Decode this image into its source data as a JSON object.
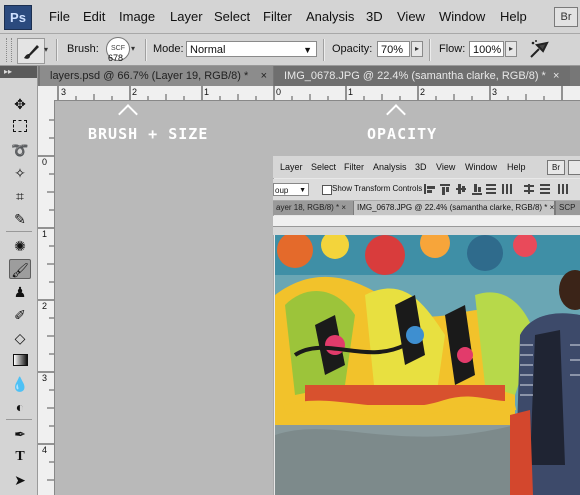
{
  "app": {
    "logo": "Ps",
    "br_badge": "Br"
  },
  "menu": [
    "File",
    "Edit",
    "Image",
    "Layer",
    "Select",
    "Filter",
    "Analysis",
    "3D",
    "View",
    "Window",
    "Help"
  ],
  "options": {
    "brush_label": "Brush:",
    "brush_size": "678",
    "brush_preview_text": "SCF",
    "mode_label": "Mode:",
    "mode_value": "Normal",
    "opacity_label": "Opacity:",
    "opacity_value": "70%",
    "flow_label": "Flow:",
    "flow_value": "100%"
  },
  "tabs": [
    {
      "label": "layers.psd @ 66.7% (Layer 19, RGB/8) *",
      "close": "×"
    },
    {
      "label": "IMG_0678.JPG @ 22.4% (samantha clarke, RGB/8) *",
      "close": "×"
    }
  ],
  "ruler_top": [
    "3",
    "2",
    "1",
    "0",
    "1",
    "2",
    "3"
  ],
  "ruler_left": [
    "0",
    "1",
    "2",
    "3",
    "4"
  ],
  "annotations": {
    "brush": "BRUSH + SIZE",
    "opacity": "OPACITY"
  },
  "inner": {
    "menu": [
      "Layer",
      "Select",
      "Filter",
      "Analysis",
      "3D",
      "View",
      "Window",
      "Help"
    ],
    "br_badge": "Br",
    "partial_field": "oup",
    "show_transform": "Show Transform Controls",
    "tabs": [
      {
        "label": "ayer 18, RGB/8) *",
        "close": "×"
      },
      {
        "label": "IMG_0678.JPG @ 22.4% (samantha clarke, RGB/8) *",
        "close": "×"
      },
      {
        "label": "SCP"
      }
    ]
  },
  "icons": {
    "tools": [
      "move-icon",
      "marquee-icon",
      "lasso-icon",
      "magic-wand-icon",
      "crop-icon",
      "eyedropper-icon",
      "spot-heal-icon",
      "brush-icon",
      "clone-stamp-icon",
      "history-brush-icon",
      "eraser-icon",
      "gradient-icon",
      "blur-icon",
      "dodge-icon",
      "pen-icon",
      "type-icon",
      "path-select-icon"
    ]
  },
  "colors": {
    "menubar": "#d4d4d4",
    "canvas": "#b9b9b9",
    "ps_blue": "#2b4a7e",
    "annotation": "#ffffff"
  }
}
